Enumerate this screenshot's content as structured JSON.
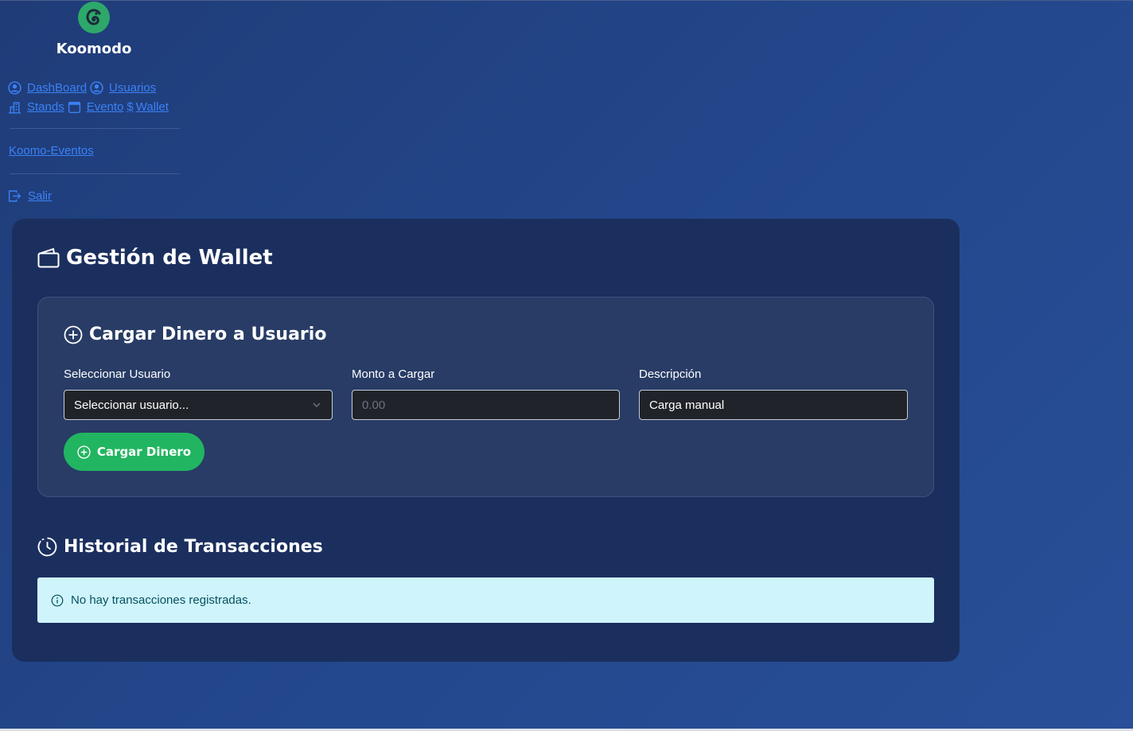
{
  "brand": {
    "name": "Koomodo",
    "logo_icon": "chameleon-logo-icon",
    "logo_color": "#2ea86a"
  },
  "nav": {
    "items": [
      {
        "label": "DashBoard",
        "icon": "user-circle-icon"
      },
      {
        "label": "Usuarios",
        "icon": "user-circle-icon"
      },
      {
        "label": "Stands",
        "icon": "buildings-icon"
      },
      {
        "label": "Evento",
        "icon": "calendar-icon"
      },
      {
        "label": "Wallet",
        "icon": "dollar-icon",
        "prefix": "$"
      }
    ],
    "koomo_link": "Koomo-Eventos",
    "logout": {
      "label": "Salir",
      "icon": "logout-icon"
    },
    "link_color": "#3b82f6"
  },
  "main": {
    "title": "Gestión de Wallet",
    "title_icon": "wallet-icon",
    "load_card": {
      "title": "Cargar Dinero a Usuario",
      "title_icon": "plus-circle-icon",
      "user_field": {
        "label": "Seleccionar Usuario",
        "value": "Seleccionar usuario..."
      },
      "amount_field": {
        "label": "Monto a Cargar",
        "placeholder": "0.00"
      },
      "description_field": {
        "label": "Descripción",
        "value": "Carga manual"
      },
      "submit_label": "Cargar Dinero",
      "submit_color": "#22b561"
    },
    "history": {
      "title": "Historial de Transacciones",
      "title_icon": "clock-history-icon",
      "empty_message": "No hay transacciones registradas."
    }
  }
}
